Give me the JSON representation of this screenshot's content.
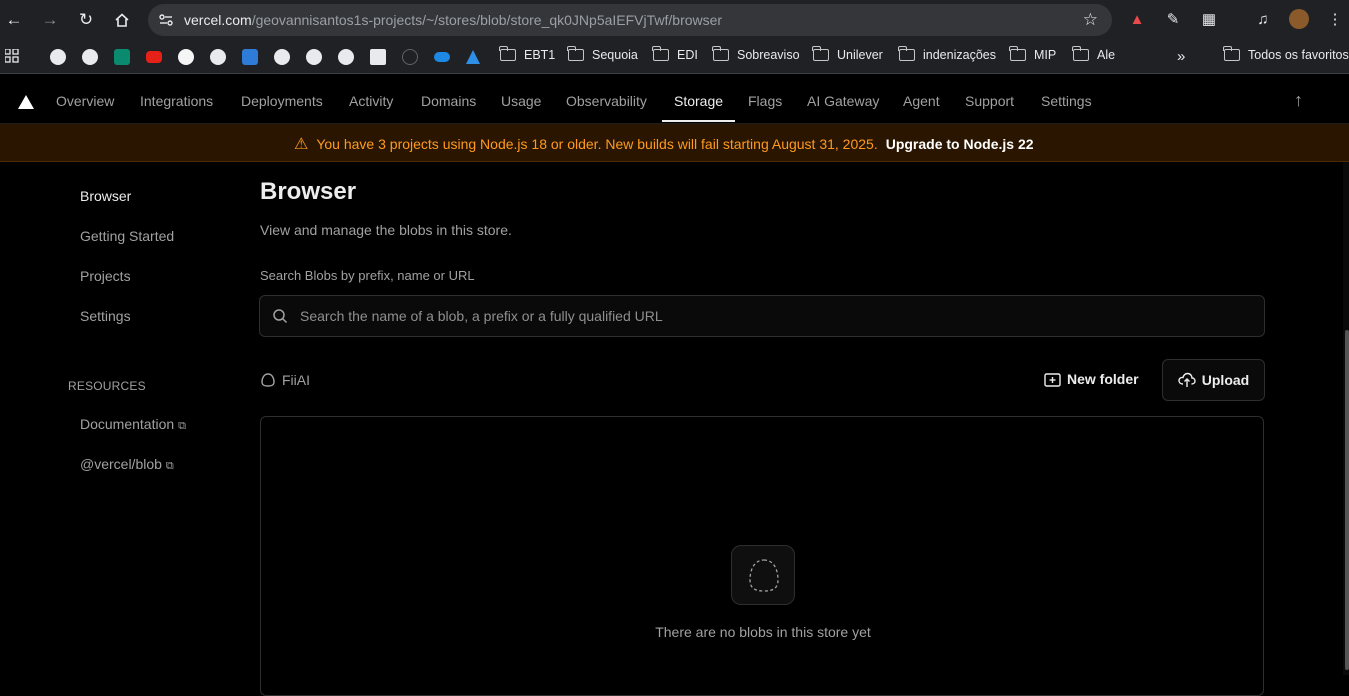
{
  "browser": {
    "url_host": "vercel.com",
    "url_path": "/geovannisantos1s-projects/~/stores/blob/store_qk0JNp5aIEFVjTwf/browser",
    "bookmarks": [
      "EBT1",
      "Sequoia",
      "EDI",
      "Sobreaviso",
      "Unilever",
      "indenizações",
      "MIP",
      "Ale"
    ],
    "all_bookmarks_label": "Todos os favoritos",
    "more_label": "»"
  },
  "topnav": {
    "tabs": [
      "Overview",
      "Integrations",
      "Deployments",
      "Activity",
      "Domains",
      "Usage",
      "Observability",
      "Storage",
      "Flags",
      "AI Gateway",
      "Agent",
      "Support",
      "Settings"
    ],
    "active_tab": "Storage"
  },
  "banner": {
    "message": "You have 3 projects using Node.js 18 or older. New builds will fail starting August 31, 2025.",
    "cta": "Upgrade to Node.js 22",
    "color": "#ff9a1f"
  },
  "sidebar": {
    "items": [
      "Browser",
      "Getting Started",
      "Projects",
      "Settings"
    ],
    "active": "Browser",
    "resources_heading": "RESOURCES",
    "resources": [
      "Documentation",
      "@vercel/blob"
    ]
  },
  "main": {
    "title": "Browser",
    "subtitle": "View and manage the blobs in this store.",
    "search_label": "Search Blobs by prefix, name or URL",
    "search_placeholder": "Search the name of a blob, a prefix or a fully qualified URL",
    "current_folder": "FiiAI",
    "new_folder_label": "New folder",
    "upload_label": "Upload",
    "empty_text": "There are no blobs in this store yet"
  }
}
